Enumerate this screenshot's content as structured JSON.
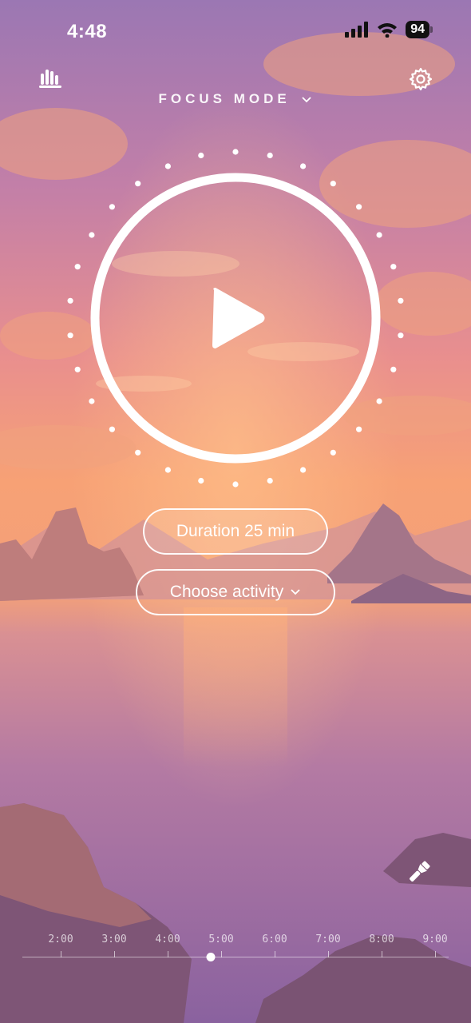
{
  "status_bar": {
    "time": "4:48",
    "battery": "94"
  },
  "header": {
    "mode_label": "FOCUS MODE",
    "stats_icon": "bar-chart-icon",
    "settings_icon": "gear-icon"
  },
  "timer": {
    "play_icon": "play-icon"
  },
  "controls": {
    "duration_label": "Duration 25 min",
    "activity_label": "Choose activity"
  },
  "timeline": {
    "labels": [
      "2:00",
      "3:00",
      "4:00",
      "5:00",
      "6:00",
      "7:00",
      "8:00",
      "9:00"
    ],
    "selected": "5:00"
  },
  "colors": {
    "accent": "#ffffff",
    "sky_top": "#8f6fb0",
    "sunset": "#f49a6c",
    "water": "#9a6aa6"
  }
}
